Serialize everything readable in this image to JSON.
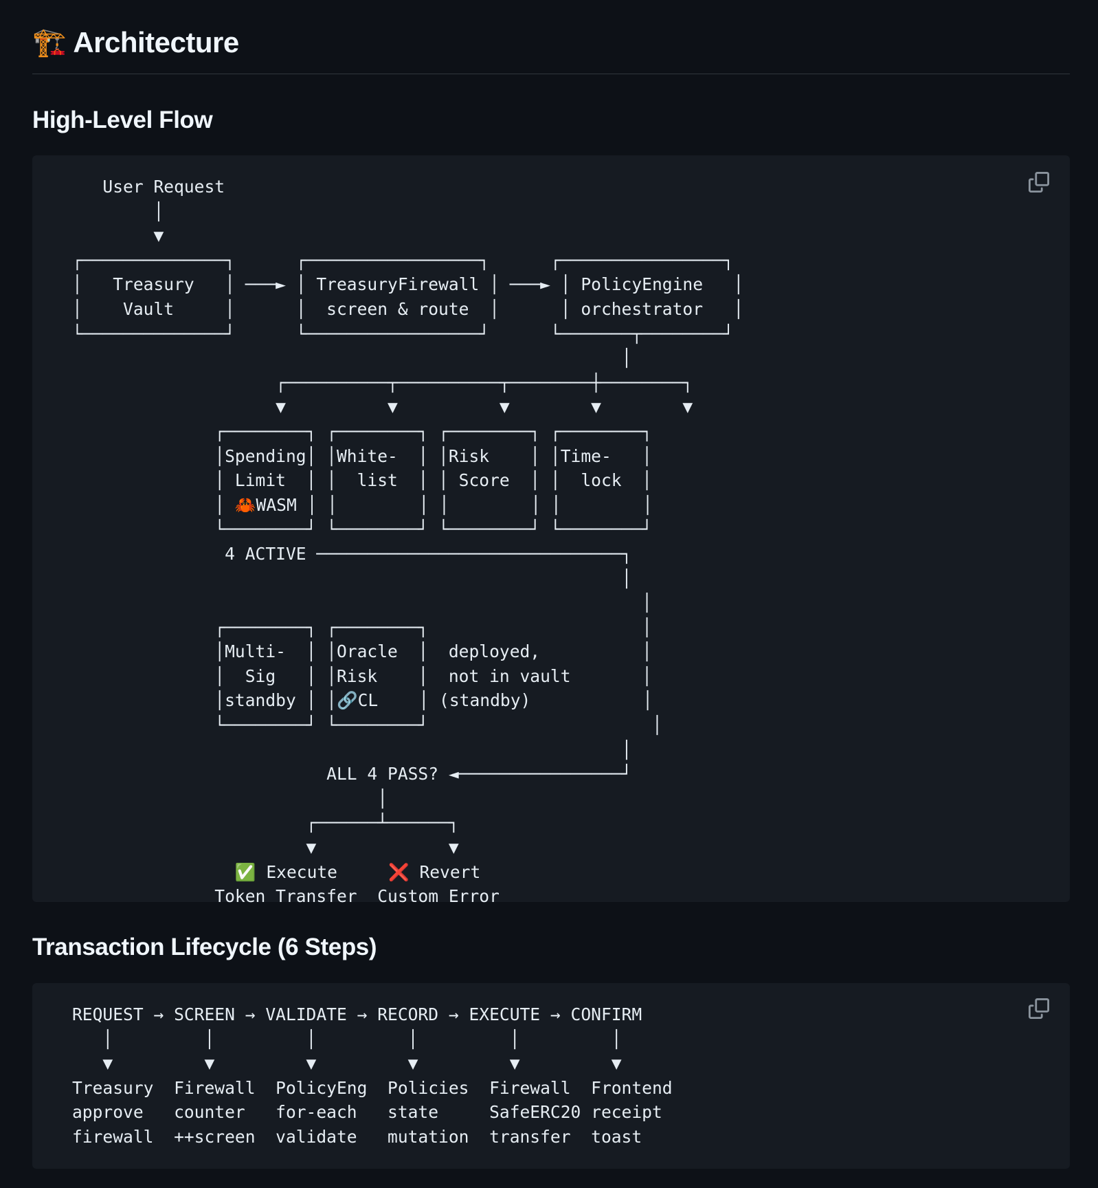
{
  "header": {
    "icon": "construction-crane-icon",
    "emoji": "🏗️",
    "title": "Architecture"
  },
  "sections": {
    "flow": {
      "heading": "High-Level Flow",
      "code": "   User Request\n        │\n        ▼\n┌──────────────┐      ┌─────────────────┐      ┌────────────────┐\n│   Treasury   │ ───► │ TreasuryFirewall │ ───► │ PolicyEngine   │\n│    Vault     │      │  screen & route  │      │ orchestrator   │\n└──────────────┘      └─────────────────┘      └───────┬────────┘\n                                                      │\n                    ┌──────────┬──────────┬────────┼────────┐\n                    ▼          ▼          ▼        ▼        ▼\n              ┌────────┐ ┌────────┐ ┌────────┐ ┌────────┐\n              │Spending│ │White-  │ │Risk    │ │Time-   │\n              │ Limit  │ │  list  │ │ Score  │ │  lock  │\n              │ 🦀WASM │ │        │ │        │ │        │\n              └────────┘ └────────┘ └────────┘ └────────┘\n               4 ACTIVE ──────────────────────────────┐\n                                                      │\n                                                        │\n              ┌────────┐ ┌────────┐                     │\n              │Multi-  │ │Oracle  │  deployed,          │\n              │  Sig   │ │Risk    │  not in vault       │\n              │standby │ │🔗CL    │ (standby)           │\n              └────────┘ └────────┘                      │\n                                                      │\n                         ALL 4 PASS? ◄────────────────┘\n                              │\n                       ┌──────┴──────┐\n                       ▼             ▼\n                ✅ Execute     ❌ Revert\n              Token Transfer  Custom Error"
    },
    "lifecycle": {
      "heading": "Transaction Lifecycle (6 Steps)",
      "code": "REQUEST → SCREEN → VALIDATE → RECORD → EXECUTE → CONFIRM\n   │         │         │         │         │         │\n   ▼         ▼         ▼         ▼         ▼         ▼\nTreasury  Firewall  PolicyEng  Policies  Firewall  Frontend\napprove   counter   for-each   state     SafeERC20 receipt\nfirewall  ++screen  validate   mutation  transfer  toast"
    }
  },
  "copy_button": {
    "icon": "copy-icon"
  }
}
